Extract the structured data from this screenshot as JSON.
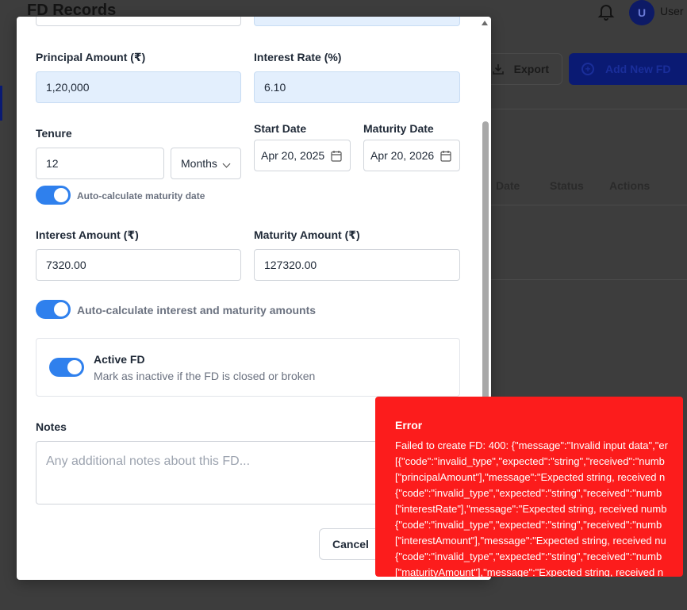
{
  "background": {
    "page_title": "FD Records",
    "user_initial": "U",
    "user_label": "User",
    "export_label": "Export",
    "add_label": "Add New FD",
    "table_headers": [
      "Date",
      "Status",
      "Actions"
    ]
  },
  "form": {
    "principal_label": "Principal Amount (₹)",
    "principal_value": "1,20,000",
    "rate_label": "Interest Rate (%)",
    "rate_value": "6.10",
    "tenure_label": "Tenure",
    "tenure_value": "12",
    "tenure_unit": "Months",
    "start_label": "Start Date",
    "start_value": "Apr 20, 2025",
    "maturity_date_label": "Maturity Date",
    "maturity_date_value": "Apr 20, 2026",
    "auto_maturity_label": "Auto-calculate maturity date",
    "interest_amount_label": "Interest Amount (₹)",
    "interest_amount_value": "7320.00",
    "maturity_amount_label": "Maturity Amount (₹)",
    "maturity_amount_value": "127320.00",
    "auto_amounts_label": "Auto-calculate interest and maturity amounts",
    "active_title": "Active FD",
    "active_subtitle": "Mark as inactive if the FD is closed or broken",
    "notes_label": "Notes",
    "notes_placeholder": "Any additional notes about this FD...",
    "cancel_label": "Cancel",
    "auto_maturity_enabled": true,
    "auto_amounts_enabled": true,
    "active_enabled": true
  },
  "error": {
    "title": "Error",
    "message": "Failed to create FD: 400: {\"message\":\"Invalid input data\",\"er\n[{\"code\":\"invalid_type\",\"expected\":\"string\",\"received\":\"numb\n[\"principalAmount\"],\"message\":\"Expected string, received n\n{\"code\":\"invalid_type\",\"expected\":\"string\",\"received\":\"numb\n[\"interestRate\"],\"message\":\"Expected string, received numb\n{\"code\":\"invalid_type\",\"expected\":\"string\",\"received\":\"numb\n[\"interestAmount\"],\"message\":\"Expected string, received nu\n{\"code\":\"invalid_type\",\"expected\":\"string\",\"received\":\"numb\n[\"maturityAmount\"],\"message\":\"Expected string, received n"
  },
  "colors": {
    "accent": "#2f80ed",
    "error_bg": "#fc1c1c",
    "filled_input_bg": "#e3effd"
  }
}
